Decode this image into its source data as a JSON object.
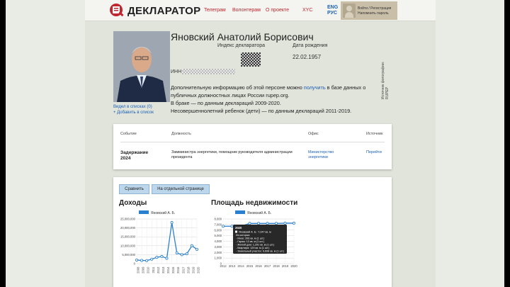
{
  "header": {
    "logo_text": "ДЕКЛАРАТОР",
    "nav": [
      "Телеграм",
      "Волонтерам",
      "О проекте",
      "XYC"
    ],
    "lang_en": "ENG",
    "lang_ru": "РУС",
    "login_line1": "Войти / Регистрация",
    "login_line2": "Напомнить пароль"
  },
  "profile": {
    "name": "Яновский Анатолий Борисович",
    "index_label": "Индекс декларатора",
    "birth_label": "Дата рождения",
    "birth_date": "22.02.1957",
    "inn_label": "ИНН",
    "desc_prefix": "Дополнительную информацию об этой персоне можно ",
    "desc_link": "получить",
    "desc_suffix": " в базе данных о публичных должностных лицах России rupep.org.",
    "marriage": "В браке — по данным деклараций 2009-2020.",
    "children": "Несовершеннолетний ребенок (дети) — по данным деклараций 2011-2019.",
    "photo_source": "Источник фотографии:",
    "photo_source_name": "RUPEP",
    "seen_link": "Видел в списках (0)",
    "add_link": "+ Добавить в список"
  },
  "events_table": {
    "headers": [
      "Событие",
      "Должность",
      "Офис",
      "Источник"
    ],
    "row": {
      "event": "Задержание 2024",
      "position": "Замминистра энергетики, помощник руководителя администрации президента",
      "office": "Министерство энергетики",
      "source": "Перейти"
    }
  },
  "charts_panel": {
    "compare_button": "Сравнить",
    "separate_button": "На отдельной странице"
  },
  "chart_data": [
    {
      "type": "line",
      "title": "Доходы",
      "series": [
        {
          "name": "Яновский А. Б.",
          "values": [
            2000000,
            1800000,
            1700000,
            2500000,
            3500000,
            4000000,
            3000000,
            23000000,
            6000000,
            5000000,
            5500000,
            10000000,
            8000000
          ]
        }
      ],
      "x": [
        "2008",
        "2009",
        "2010",
        "2011",
        "2012",
        "2013",
        "2014",
        "2015",
        "2016",
        "2017",
        "2018",
        "2019",
        "2020"
      ],
      "yticks": [
        "0",
        "5,000,000",
        "10,000,000",
        "15,000,000",
        "20,000,000",
        "25,000,000"
      ],
      "ylim": [
        0,
        25000000
      ],
      "color": "#2a7fce"
    },
    {
      "type": "line",
      "title": "Площадь недвижимости",
      "series": [
        {
          "name": "Яновский А. Б.",
          "values": [
            6700,
            6700,
            6700,
            7200,
            7200,
            7200,
            7200,
            7247,
            7247
          ]
        }
      ],
      "x": [
        "2012",
        "2013",
        "2014",
        "2015",
        "2016",
        "2017",
        "2018",
        "2019",
        "2020"
      ],
      "yticks": [
        "0",
        "1,000",
        "2,000",
        "3,000",
        "4,000",
        "5,000",
        "6,000",
        "7,000",
        "8,000"
      ],
      "ylim": [
        0,
        8000
      ],
      "color": "#2a7fce",
      "tooltip": {
        "title": "2020",
        "lines": [
          "Яновский А. Б.: 7,247 кв. м",
          "Из которых:",
          "- Иное: 206 кв. м (1 шт.)",
          "- Гараж: 13 кв. м (1 шт.)",
          "- Жилой дом: 1,291 кв. м (1 шт.)",
          "- Квартира: 129 кв. м (1 шт.)",
          "- Земельный участок: 6,608 кв. м (1 шт.)"
        ]
      }
    }
  ]
}
